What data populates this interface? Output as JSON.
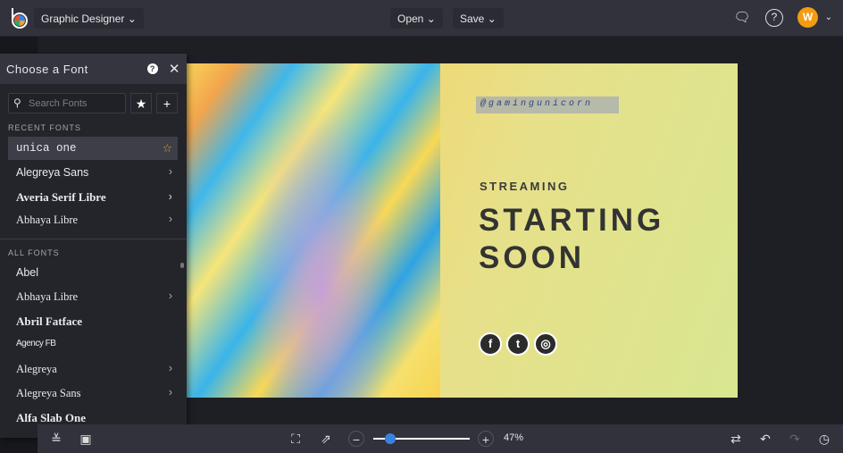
{
  "topbar": {
    "mode": "Graphic Designer",
    "open": "Open",
    "save": "Save",
    "avatar": "W"
  },
  "panel": {
    "title": "Choose a Font",
    "search_placeholder": "Search Fonts",
    "recent_label": "RECENT FONTS",
    "all_label": "ALL FONTS",
    "recent": [
      {
        "label": "unica one",
        "selected": true
      },
      {
        "label": "Alegreya Sans"
      },
      {
        "label": "Averia Serif Libre"
      },
      {
        "label": "Abhaya Libre"
      }
    ],
    "all": [
      {
        "label": "Abel"
      },
      {
        "label": "Abhaya Libre",
        "more": true
      },
      {
        "label": "Abril Fatface"
      },
      {
        "label": "Agency FB"
      },
      {
        "label": "Alegreya",
        "more": true
      },
      {
        "label": "Alegreya Sans",
        "more": true
      },
      {
        "label": "Alfa Slab One"
      }
    ]
  },
  "canvas": {
    "handle": "@gamingunicorn",
    "subtitle": "STREAMING",
    "title_line1": "STARTING",
    "title_line2": "SOON",
    "social": [
      "f",
      "t",
      "◎"
    ]
  },
  "bottom": {
    "zoom_label": "47%",
    "zoom_percent": 47
  }
}
